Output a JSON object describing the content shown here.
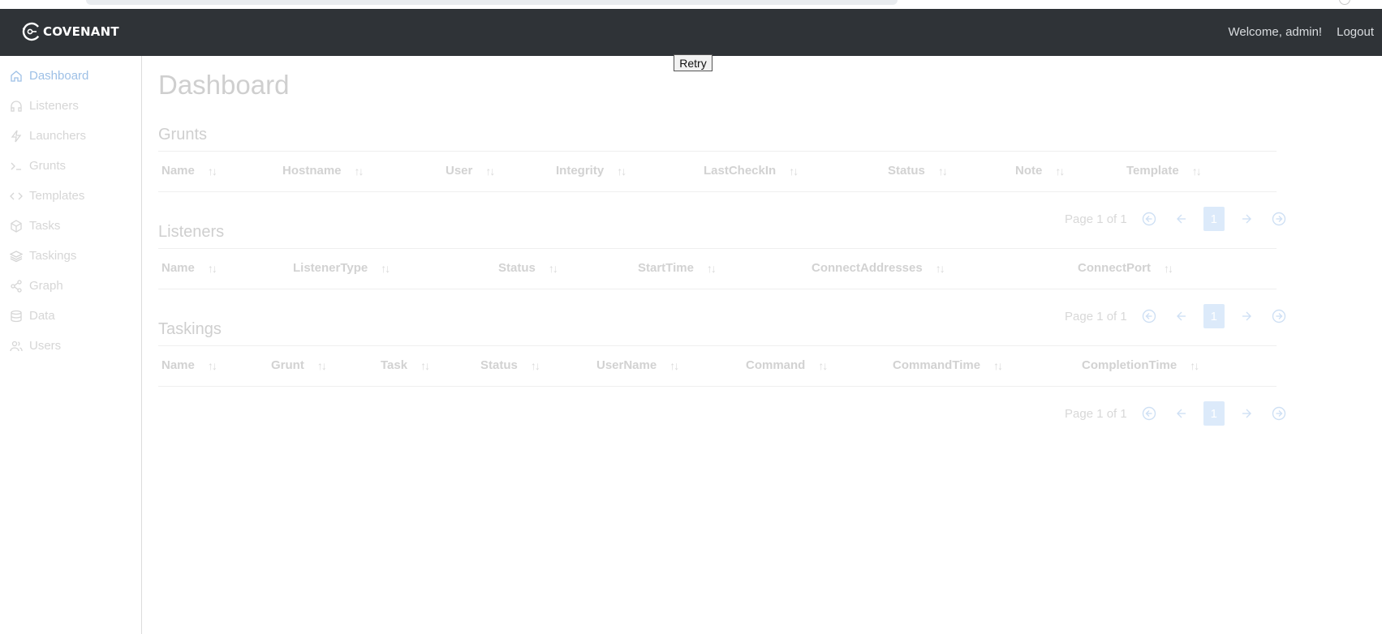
{
  "navbar": {
    "brand": "COVENANT",
    "welcome": "Welcome, admin!",
    "logout": "Logout"
  },
  "sidebar": {
    "items": [
      {
        "label": "Dashboard",
        "icon": "home-icon",
        "active": true
      },
      {
        "label": "Listeners",
        "icon": "headphones-icon"
      },
      {
        "label": "Launchers",
        "icon": "zap-icon"
      },
      {
        "label": "Grunts",
        "icon": "terminal-icon"
      },
      {
        "label": "Templates",
        "icon": "code-icon"
      },
      {
        "label": "Tasks",
        "icon": "box-icon"
      },
      {
        "label": "Taskings",
        "icon": "layers-icon"
      },
      {
        "label": "Graph",
        "icon": "share-icon"
      },
      {
        "label": "Data",
        "icon": "database-icon"
      },
      {
        "label": "Users",
        "icon": "users-icon"
      }
    ]
  },
  "retry_label": "Retry",
  "page_title": "Dashboard",
  "sections": {
    "grunts": {
      "title": "Grunts",
      "columns": [
        "Name",
        "Hostname",
        "User",
        "Integrity",
        "LastCheckIn",
        "Status",
        "Note",
        "Template"
      ],
      "pager": {
        "info": "Page 1 of 1",
        "current": "1"
      }
    },
    "listeners": {
      "title": "Listeners",
      "columns": [
        "Name",
        "ListenerType",
        "Status",
        "StartTime",
        "ConnectAddresses",
        "ConnectPort"
      ],
      "pager": {
        "info": "Page 1 of 1",
        "current": "1"
      }
    },
    "taskings": {
      "title": "Taskings",
      "columns": [
        "Name",
        "Grunt",
        "Task",
        "Status",
        "UserName",
        "Command",
        "CommandTime",
        "CompletionTime"
      ],
      "pager": {
        "info": "Page 1 of 1",
        "current": "1"
      }
    }
  },
  "sort_glyph": "↑↓",
  "colors": {
    "navbar": "#2f3337",
    "active_link": "#9ec0e6",
    "page_current": "#dceafa"
  }
}
